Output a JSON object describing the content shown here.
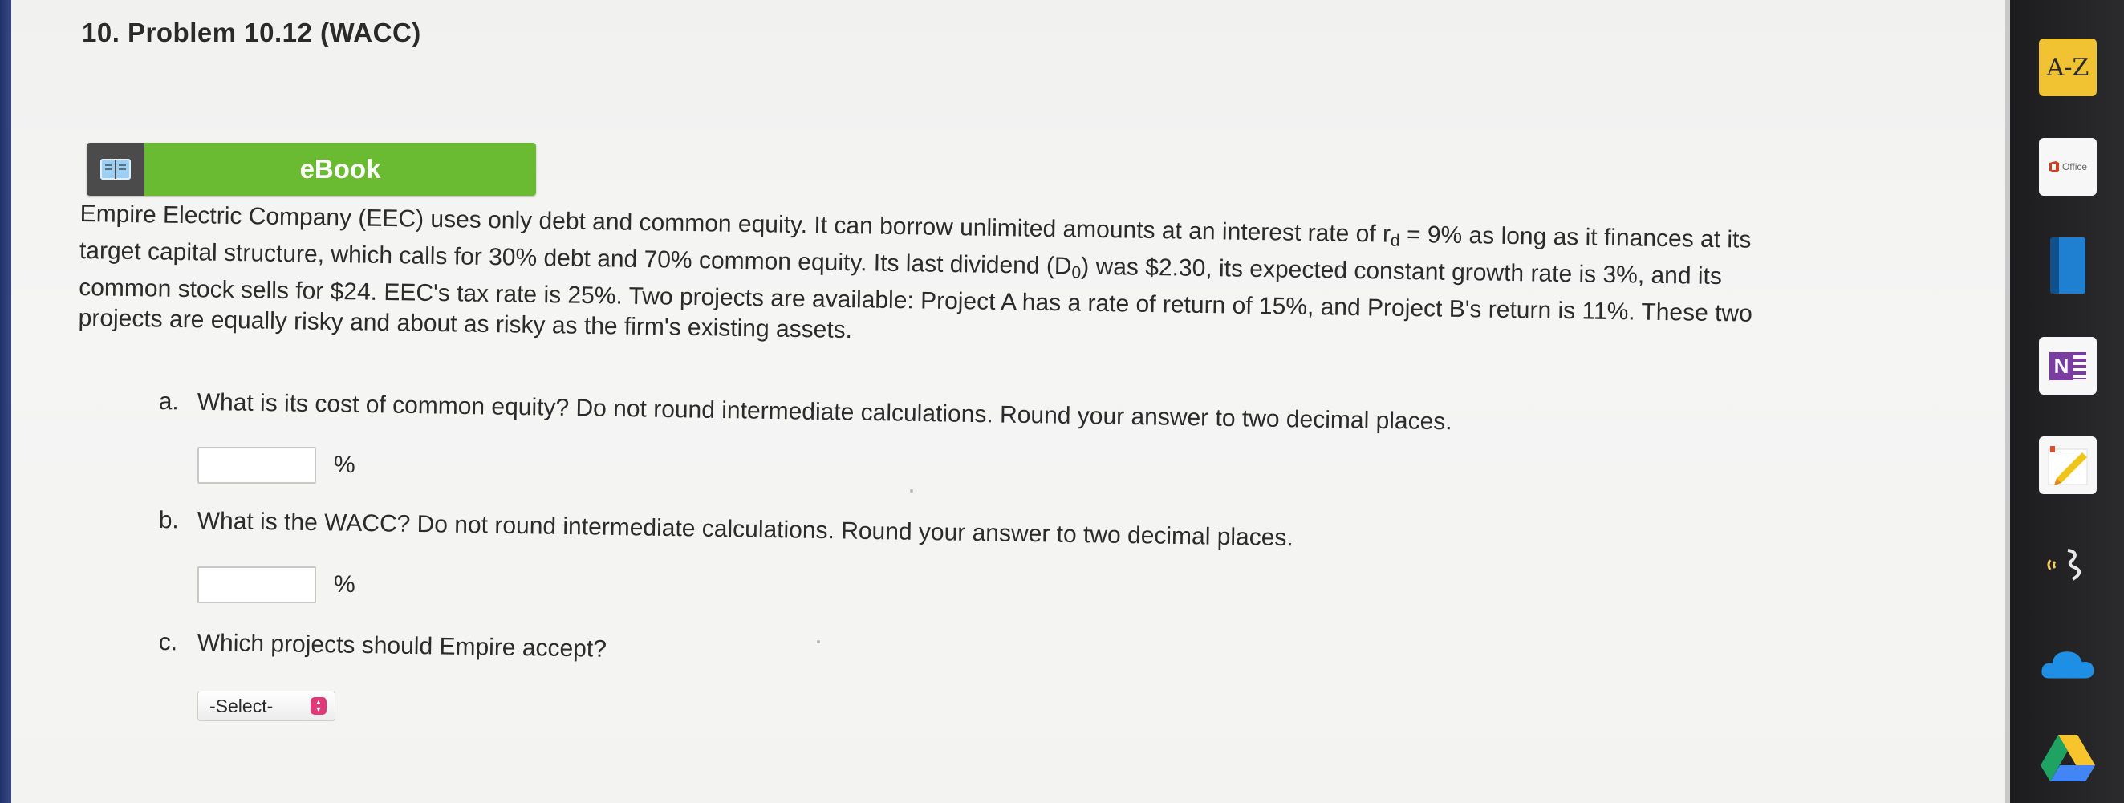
{
  "header": {
    "title": "10. Problem 10.12 (WACC)"
  },
  "ebook": {
    "label": "eBook",
    "icon": "book-icon"
  },
  "problem": {
    "lines": [
      "Empire Electric Company (EEC) uses only debt and common equity. It can borrow unlimited amounts at an interest rate of r",
      "target capital structure, which calls for 30% debt and 70% common equity. Its last dividend (D",
      "common stock sells for $24. EEC's tax rate is 25%. Two projects are available: Project A has a rate of return of 15%, and Project B's return is 11%. These two",
      "projects are equally risky and about as risky as the firm's existing assets."
    ],
    "line1_sub": "d",
    "line1_tail": " = 9% as long as it finances at its",
    "line2_sub": "0",
    "line2_tail": ") was $2.30, its expected constant growth rate is 3%, and its"
  },
  "questions": {
    "a": {
      "letter": "a.",
      "text": "What is its cost of common equity? Do not round intermediate calculations. Round your answer to two decimal places.",
      "value": "",
      "unit": "%"
    },
    "b": {
      "letter": "b.",
      "text": "What is the WACC? Do not round intermediate calculations. Round your answer to two decimal places.",
      "value": "",
      "unit": "%"
    },
    "c": {
      "letter": "c.",
      "text": "Which projects should Empire accept?",
      "select_value": "-Select-"
    }
  },
  "dock": {
    "items": [
      {
        "name": "A-Z",
        "icon": "dictionary-icon"
      },
      {
        "name": "Office",
        "icon": "office-icon"
      },
      {
        "name": "",
        "icon": "book-app-icon"
      },
      {
        "name": "N",
        "icon": "onenote-icon"
      },
      {
        "name": "",
        "icon": "notes-icon"
      },
      {
        "name": "",
        "icon": "voice-memo-icon"
      },
      {
        "name": "",
        "icon": "onedrive-icon"
      },
      {
        "name": "",
        "icon": "google-drive-icon"
      }
    ],
    "office_label": "Office"
  },
  "colors": {
    "ebook_green": "#6abb32",
    "ebook_icon_bg": "#4b4b4b",
    "select_accent": "#e2387a",
    "az_yellow": "#f1c232"
  }
}
